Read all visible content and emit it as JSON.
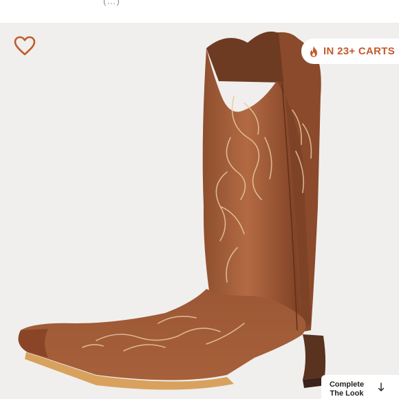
{
  "header": {
    "partial_text": "(…)"
  },
  "favorite": {
    "icon": "heart-icon",
    "color": "#c25a2b"
  },
  "badge": {
    "icon": "flame-icon",
    "label": "IN 23+ CARTS",
    "color": "#c25a2b"
  },
  "product_image": {
    "subject": "brown leather cowboy boot with embroidered shaft"
  },
  "complete_look": {
    "line1": "Complete",
    "line2": "The Look",
    "icon": "arrow-down-icon"
  }
}
